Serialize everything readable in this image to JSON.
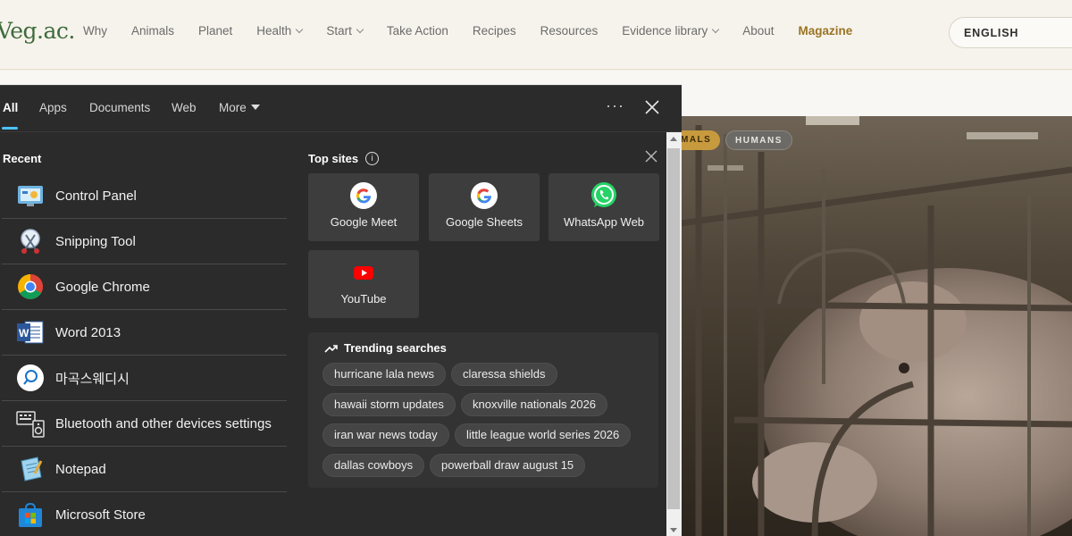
{
  "site": {
    "logo": "Veg.ac.",
    "nav": [
      {
        "label": "Why"
      },
      {
        "label": "Animals"
      },
      {
        "label": "Planet"
      },
      {
        "label": "Health"
      },
      {
        "label": "Start"
      },
      {
        "label": "Take Action"
      },
      {
        "label": "Recipes"
      },
      {
        "label": "Resources"
      },
      {
        "label": "Evidence library"
      },
      {
        "label": "About"
      },
      {
        "label": "Magazine"
      }
    ],
    "language": "ENGLISH",
    "tags": [
      "MALS",
      "HUMANS"
    ]
  },
  "search_panel": {
    "tabs": {
      "all": "All",
      "apps": "Apps",
      "documents": "Documents",
      "web": "Web",
      "more": "More"
    },
    "more_options": "···",
    "recent_title": "Recent",
    "recent": [
      {
        "label": "Control Panel",
        "icon": "control-panel-icon"
      },
      {
        "label": "Snipping Tool",
        "icon": "snipping-tool-icon"
      },
      {
        "label": "Google Chrome",
        "icon": "chrome-icon"
      },
      {
        "label": "Word 2013",
        "icon": "word-icon"
      },
      {
        "label": "마곡스웨디시",
        "icon": "search-icon"
      },
      {
        "label": "Bluetooth and other devices settings",
        "icon": "bluetooth-devices-icon"
      },
      {
        "label": "Notepad",
        "icon": "notepad-icon"
      },
      {
        "label": "Microsoft Store",
        "icon": "store-icon"
      }
    ],
    "top_sites_title": "Top sites",
    "top_sites": [
      {
        "label": "Google Meet",
        "icon": "google-icon"
      },
      {
        "label": "Google Sheets",
        "icon": "google-icon"
      },
      {
        "label": "WhatsApp Web",
        "icon": "whatsapp-icon"
      },
      {
        "label": "YouTube",
        "icon": "youtube-icon"
      }
    ],
    "trending_title": "Trending searches",
    "trending": [
      "hurricane lala news",
      "claressa shields",
      "hawaii storm updates",
      "knoxville nationals 2026",
      "iran war news today",
      "little league world series 2026",
      "dallas cowboys",
      "powerball draw august 15"
    ]
  },
  "colors": {
    "accent": "#4cc2ff",
    "panel_bg": "#2b2b2b",
    "magazine": "#9a7425",
    "logo": "#3f6b3c"
  }
}
